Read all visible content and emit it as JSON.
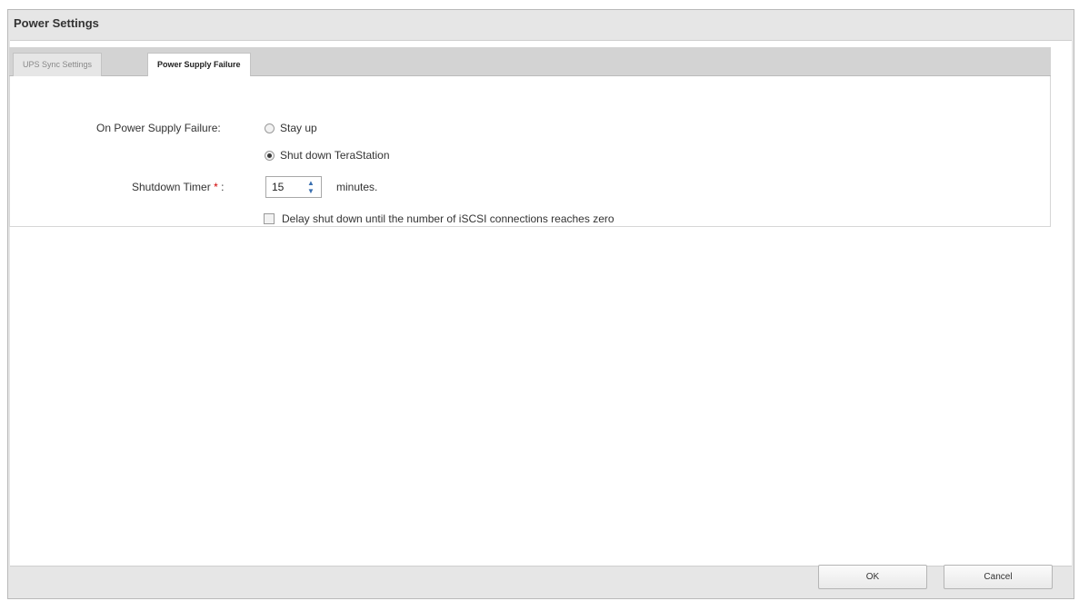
{
  "dialog": {
    "title": "Power Settings"
  },
  "tabs": [
    {
      "label": "UPS Sync Settings",
      "active": false
    },
    {
      "label": "Power Supply Failure",
      "active": true
    }
  ],
  "form": {
    "on_failure_label": "On Power Supply Failure:",
    "options": [
      {
        "label": "Stay up",
        "selected": false
      },
      {
        "label": "Shut down TeraStation",
        "selected": true
      }
    ],
    "timer_label": "Shutdown Timer",
    "required_mark": "*",
    "timer_colon": ":",
    "timer_value": "15",
    "timer_unit": "minutes.",
    "delay_label": "Delay shut down until the number of iSCSI connections reaches zero",
    "delay_checked": false
  },
  "buttons": {
    "ok": "OK",
    "cancel": "Cancel"
  },
  "help": {
    "icon": "question-icon",
    "symbol": "?",
    "caret": "▾"
  },
  "colors": {
    "help_icon": "#1f5fb8",
    "required": "#d00000"
  }
}
